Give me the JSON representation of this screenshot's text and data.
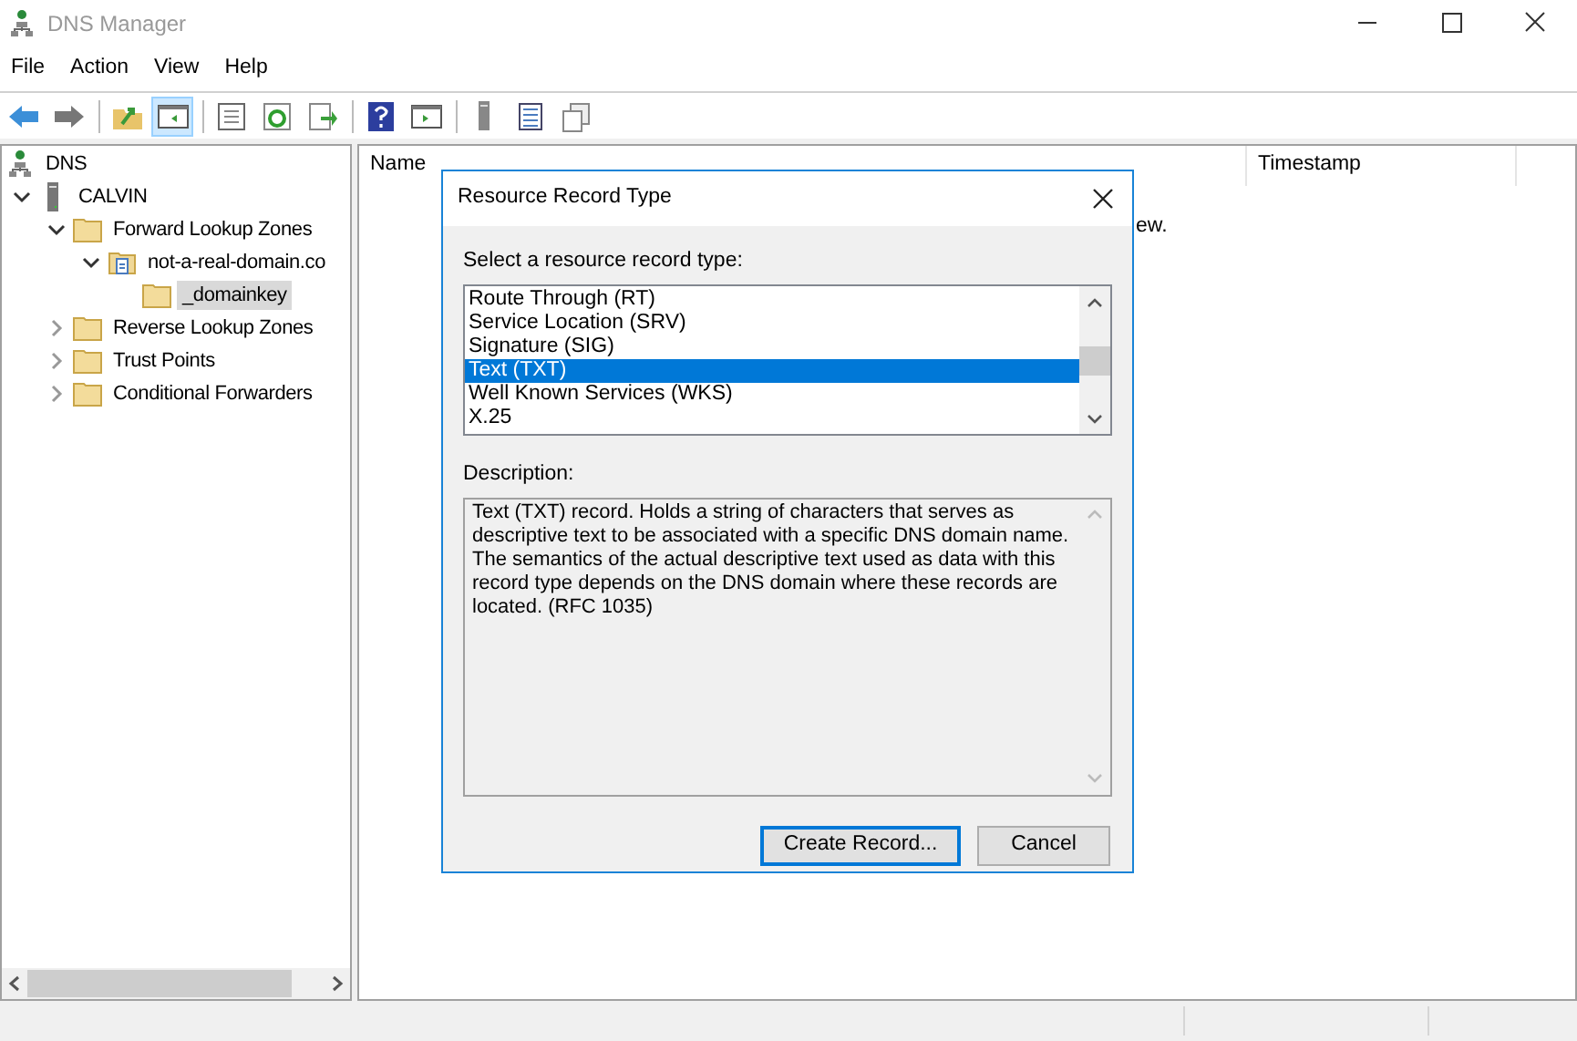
{
  "window": {
    "title": "DNS Manager"
  },
  "menu": [
    "File",
    "Action",
    "View",
    "Help"
  ],
  "toolbar": [
    {
      "kind": "back",
      "selected": false
    },
    {
      "kind": "forward",
      "selected": false
    },
    {
      "kind": "up",
      "selected": false
    },
    {
      "kind": "tree",
      "selected": true
    },
    {
      "kind": "properties",
      "selected": false
    },
    {
      "kind": "refresh",
      "selected": false
    },
    {
      "kind": "export",
      "selected": false
    },
    {
      "kind": "help",
      "selected": false
    },
    {
      "kind": "pane",
      "selected": false
    },
    {
      "kind": "server",
      "selected": false
    },
    {
      "kind": "list",
      "selected": false
    },
    {
      "kind": "copy",
      "selected": false
    }
  ],
  "tree": [
    {
      "label": "DNS",
      "kind": "dns",
      "selected": false,
      "children": [
        {
          "label": "CALVIN",
          "kind": "server",
          "expanded": true,
          "selected": false,
          "children": [
            {
              "label": "Forward Lookup Zones",
              "kind": "folder",
              "expanded": true,
              "selected": false,
              "children": [
                {
                  "label": "not-a-real-domain.co",
                  "kind": "zone",
                  "expanded": true,
                  "selected": false,
                  "children": [
                    {
                      "label": "_domainkey",
                      "kind": "folder",
                      "selected": true
                    }
                  ]
                }
              ]
            },
            {
              "label": "Reverse Lookup Zones",
              "kind": "folder",
              "expanded": false,
              "selected": false
            },
            {
              "label": "Trust Points",
              "kind": "folder",
              "expanded": false,
              "selected": false
            },
            {
              "label": "Conditional Forwarders",
              "kind": "folder",
              "expanded": false,
              "selected": false
            }
          ]
        }
      ]
    }
  ],
  "columns": [
    "Name",
    "Timestamp"
  ],
  "empty_message": "ew.",
  "dialog": {
    "title": "Resource Record Type",
    "list_label": "Select a resource record type:",
    "record_types": [
      {
        "label": "Route Through (RT)",
        "selected": false
      },
      {
        "label": "Service Location (SRV)",
        "selected": false
      },
      {
        "label": "Signature (SIG)",
        "selected": false
      },
      {
        "label": "Text (TXT)",
        "selected": true
      },
      {
        "label": "Well Known Services (WKS)",
        "selected": false
      },
      {
        "label": "X.25",
        "selected": false
      }
    ],
    "description_label": "Description:",
    "description": "Text (TXT) record. Holds a string of characters that serves as descriptive text to be associated with a specific DNS domain name. The semantics of the actual descriptive text used as data with this record type depends on the DNS domain where these records are located. (RFC 1035)",
    "buttons": [
      {
        "label": "Create Record...",
        "default": true
      },
      {
        "label": "Cancel",
        "default": false
      }
    ]
  }
}
